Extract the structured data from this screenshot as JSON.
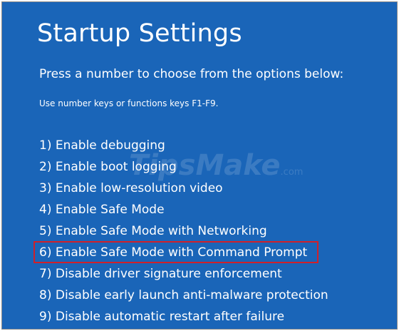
{
  "screen": {
    "title": "Startup Settings",
    "prompt": "Press a number to choose from the options below:",
    "hint": "Use number keys or functions keys F1-F9."
  },
  "options": [
    {
      "label": "1) Enable debugging"
    },
    {
      "label": "2) Enable boot logging"
    },
    {
      "label": "3) Enable low-resolution video"
    },
    {
      "label": "4) Enable Safe Mode"
    },
    {
      "label": "5) Enable Safe Mode with Networking"
    },
    {
      "label": "6) Enable Safe Mode with Command Prompt",
      "highlighted": true
    },
    {
      "label": "7) Disable driver signature enforcement"
    },
    {
      "label": "8) Disable early launch anti-malware protection"
    },
    {
      "label": "9) Disable automatic restart after failure"
    }
  ],
  "watermark": {
    "text": "TipsMake",
    "suffix": ".com"
  },
  "colors": {
    "background": "#1a65b8",
    "text": "#ffffff",
    "highlight_border": "#d0202a"
  }
}
